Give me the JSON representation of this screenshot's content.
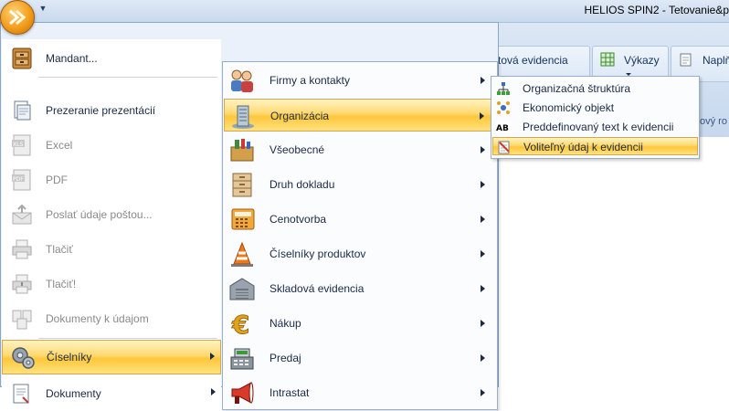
{
  "window": {
    "title": "HELIOS SPIN2 - Tetovanie&p"
  },
  "ribbon": {
    "partial_button_1": "tová evidencia",
    "vykazy_button": "Výkazy",
    "partial_button_3": "Naplň",
    "partial_group_label": "ový ro"
  },
  "app_menu": {
    "left_items": [
      {
        "label": "Mandant...",
        "icon": "drawer-cabinet-icon",
        "disabled": false
      },
      {
        "label": "Prezeranie prezentácií",
        "icon": "presentation-viewer-icon",
        "disabled": false
      },
      {
        "label": "Excel",
        "icon": "xls-file-icon",
        "disabled": true
      },
      {
        "label": "PDF",
        "icon": "pdf-file-icon",
        "disabled": true
      },
      {
        "label": "Poslať údaje poštou...",
        "icon": "send-mail-icon",
        "disabled": true
      },
      {
        "label": "Tlačiť",
        "icon": "printer-icon",
        "disabled": true
      },
      {
        "label": "Tlačiť!",
        "icon": "quick-print-icon",
        "disabled": true
      },
      {
        "label": "Dokumenty k údajom",
        "icon": "documents-icon",
        "disabled": true
      },
      {
        "label": "Číselníky",
        "icon": "gears-icon",
        "disabled": false,
        "selected": true
      },
      {
        "label": "Dokumenty",
        "icon": "document-stack-icon",
        "disabled": false
      }
    ],
    "middle_items": [
      {
        "label": "Firmy a kontakty",
        "icon": "contacts-people-icon"
      },
      {
        "label": "Organizácia",
        "icon": "organization-building-icon",
        "selected": true
      },
      {
        "label": "Všeobecné",
        "icon": "toolbox-icon"
      },
      {
        "label": "Druh dokladu",
        "icon": "filing-cabinet-icon"
      },
      {
        "label": "Cenotvorba",
        "icon": "calculator-icon"
      },
      {
        "label": "Číselníky produktov",
        "icon": "traffic-cone-icon"
      },
      {
        "label": "Skladová evidencia",
        "icon": "warehouse-icon"
      },
      {
        "label": "Nákup",
        "icon": "euro-icon"
      },
      {
        "label": "Predaj",
        "icon": "cash-register-icon"
      },
      {
        "label": "Intrastat",
        "icon": "megaphone-icon"
      }
    ],
    "right_items": [
      {
        "label": "Organizačná štruktúra",
        "icon": "org-structure-icon"
      },
      {
        "label": "Ekonomický objekt",
        "icon": "economic-object-icon"
      },
      {
        "label": "Preddefinovaný text k evidencii",
        "icon": "predefined-text-icon",
        "icon_text": "AB"
      },
      {
        "label": "Voliteľný údaj k evidencii",
        "icon": "optional-data-icon",
        "selected": true
      }
    ]
  }
}
